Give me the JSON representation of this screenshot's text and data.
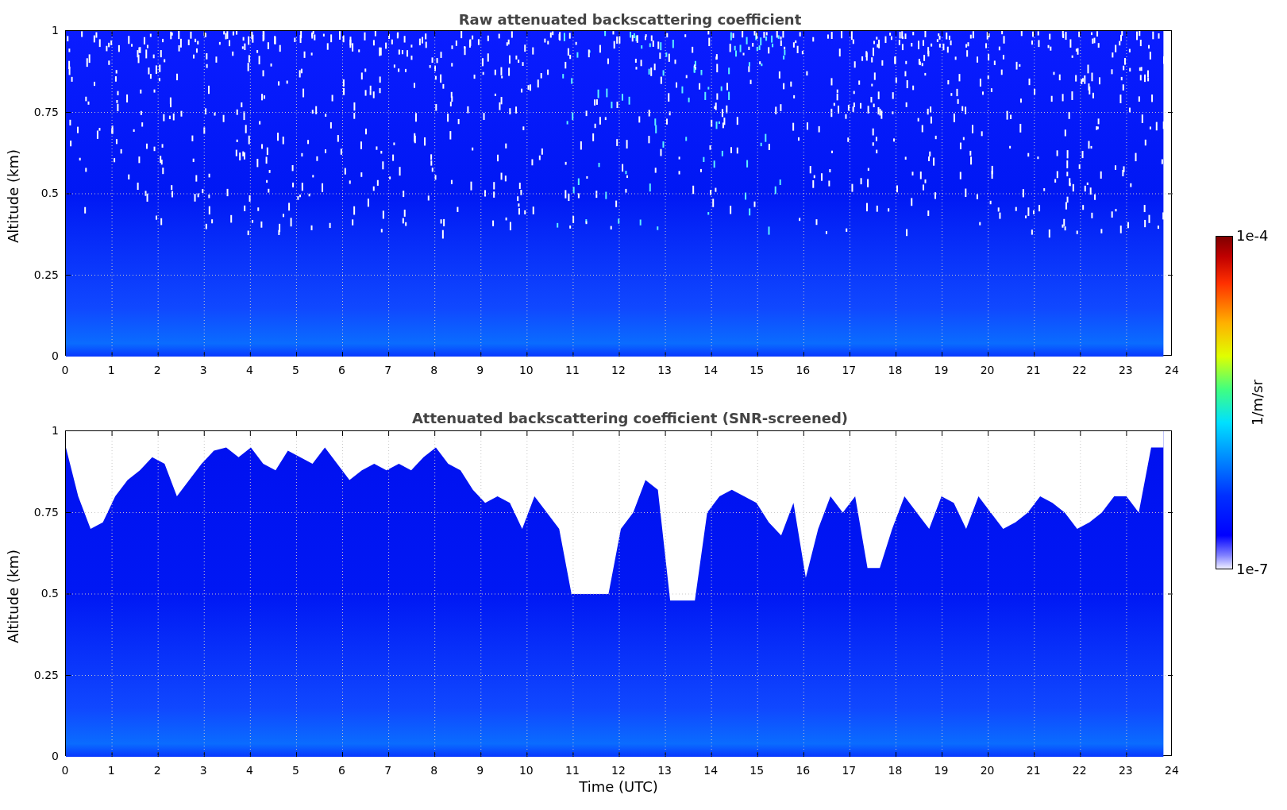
{
  "panels": [
    {
      "kind": "raw",
      "title": "Raw attenuated backscattering coefficient",
      "ylabel": "Altitude (km)",
      "yticks": [
        "1",
        "0.75",
        "0.5",
        "0.25",
        "0"
      ],
      "xticks": [
        "0",
        "1",
        "2",
        "3",
        "4",
        "5",
        "6",
        "7",
        "8",
        "9",
        "10",
        "11",
        "12",
        "13",
        "14",
        "15",
        "16",
        "17",
        "18",
        "19",
        "20",
        "21",
        "22",
        "23",
        "24"
      ]
    },
    {
      "kind": "screened",
      "title": "Attenuated backscattering coefficient (SNR-screened)",
      "ylabel": "Altitude (km)",
      "yticks": [
        "1",
        "0.75",
        "0.5",
        "0.25",
        "0"
      ],
      "xticks": [
        "0",
        "1",
        "2",
        "3",
        "4",
        "5",
        "6",
        "7",
        "8",
        "9",
        "10",
        "11",
        "12",
        "13",
        "14",
        "15",
        "16",
        "17",
        "18",
        "19",
        "20",
        "21",
        "22",
        "23",
        "24"
      ]
    }
  ],
  "xlabel": "Time (UTC)",
  "colorbar": {
    "max": "1e-4",
    "min": "1e-7",
    "label": "1/m/sr"
  }
}
